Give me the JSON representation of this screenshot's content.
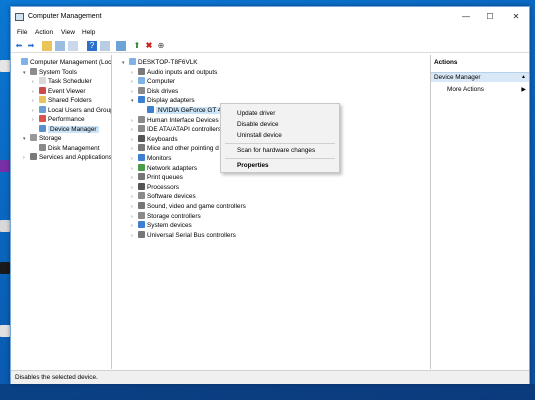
{
  "window": {
    "title": "Computer Management",
    "minimize": "—",
    "maximize": "☐",
    "close": "✕"
  },
  "menu": [
    "File",
    "Action",
    "View",
    "Help"
  ],
  "toolbar_icons": [
    "back-icon",
    "forward-icon",
    "up-icon",
    "show-hide-tree-icon",
    "properties-icon",
    "help-icon",
    "console-icon",
    "monitor-icon",
    "update-driver-icon",
    "uninstall-icon",
    "disable-icon"
  ],
  "left_tree": [
    {
      "label": "Computer Management (Local)",
      "indent": 0,
      "chev": "",
      "icon": "computer-icon"
    },
    {
      "label": "System Tools",
      "indent": 1,
      "chev": "▾",
      "icon": "tools-icon"
    },
    {
      "label": "Task Scheduler",
      "indent": 2,
      "chev": "›",
      "icon": "clock-icon"
    },
    {
      "label": "Event Viewer",
      "indent": 2,
      "chev": "›",
      "icon": "event-icon"
    },
    {
      "label": "Shared Folders",
      "indent": 2,
      "chev": "›",
      "icon": "folder-icon"
    },
    {
      "label": "Local Users and Groups",
      "indent": 2,
      "chev": "›",
      "icon": "users-icon"
    },
    {
      "label": "Performance",
      "indent": 2,
      "chev": "›",
      "icon": "performance-icon"
    },
    {
      "label": "Device Manager",
      "indent": 2,
      "chev": "",
      "icon": "device-manager-icon",
      "selected": true
    },
    {
      "label": "Storage",
      "indent": 1,
      "chev": "▾",
      "icon": "storage-icon"
    },
    {
      "label": "Disk Management",
      "indent": 2,
      "chev": "",
      "icon": "disk-icon"
    },
    {
      "label": "Services and Applications",
      "indent": 1,
      "chev": "›",
      "icon": "services-icon"
    }
  ],
  "device_tree": [
    {
      "label": "DESKTOP-T8F6VLK",
      "indent": 0,
      "chev": "▾",
      "icon": "computer-icon"
    },
    {
      "label": "Audio inputs and outputs",
      "indent": 1,
      "chev": "›",
      "icon": "audio-icon"
    },
    {
      "label": "Computer",
      "indent": 1,
      "chev": "›",
      "icon": "computer-icon"
    },
    {
      "label": "Disk drives",
      "indent": 1,
      "chev": "›",
      "icon": "disk-icon"
    },
    {
      "label": "Display adapters",
      "indent": 1,
      "chev": "▾",
      "icon": "display-icon"
    },
    {
      "label": "NVIDIA GeForce GT 420",
      "indent": 2,
      "chev": "",
      "icon": "display-icon",
      "selected": true
    },
    {
      "label": "Human Interface Devices",
      "indent": 1,
      "chev": "›",
      "icon": "hid-icon"
    },
    {
      "label": "IDE ATA/ATAPI controllers",
      "indent": 1,
      "chev": "›",
      "icon": "ide-icon"
    },
    {
      "label": "Keyboards",
      "indent": 1,
      "chev": "›",
      "icon": "keyboard-icon"
    },
    {
      "label": "Mice and other pointing d",
      "indent": 1,
      "chev": "›",
      "icon": "mouse-icon"
    },
    {
      "label": "Monitors",
      "indent": 1,
      "chev": "›",
      "icon": "monitor-icon"
    },
    {
      "label": "Network adapters",
      "indent": 1,
      "chev": "›",
      "icon": "network-icon"
    },
    {
      "label": "Print queues",
      "indent": 1,
      "chev": "›",
      "icon": "printer-icon"
    },
    {
      "label": "Processors",
      "indent": 1,
      "chev": "›",
      "icon": "processor-icon"
    },
    {
      "label": "Software devices",
      "indent": 1,
      "chev": "›",
      "icon": "software-icon"
    },
    {
      "label": "Sound, video and game controllers",
      "indent": 1,
      "chev": "›",
      "icon": "sound-icon"
    },
    {
      "label": "Storage controllers",
      "indent": 1,
      "chev": "›",
      "icon": "storage-controller-icon"
    },
    {
      "label": "System devices",
      "indent": 1,
      "chev": "›",
      "icon": "system-icon"
    },
    {
      "label": "Universal Serial Bus controllers",
      "indent": 1,
      "chev": "›",
      "icon": "usb-icon"
    }
  ],
  "context_menu": {
    "update_driver": "Update driver",
    "disable_device": "Disable device",
    "uninstall_device": "Uninstall device",
    "scan": "Scan for hardware changes",
    "properties": "Properties"
  },
  "actions": {
    "header": "Actions",
    "section": "Device Manager",
    "more": "More Actions"
  },
  "status": "Disables the selected device.",
  "colors": {
    "selection": "#cce4f7",
    "desktop": "#0a6bc7"
  }
}
